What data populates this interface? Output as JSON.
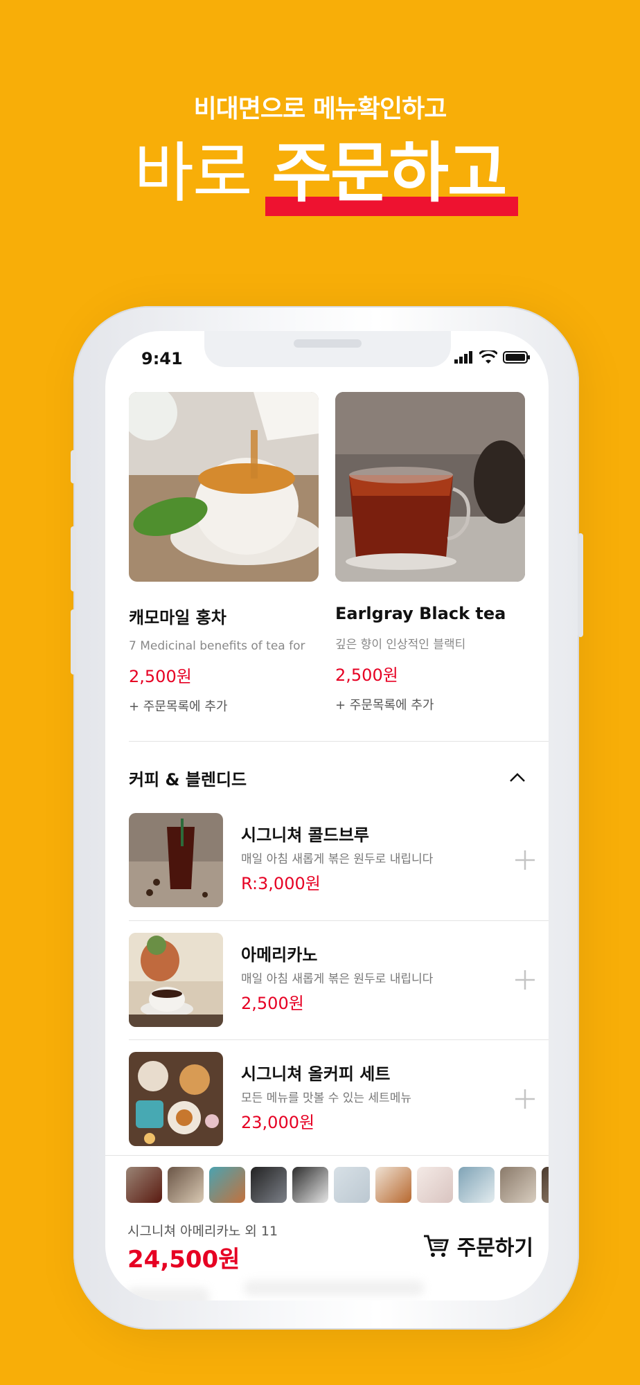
{
  "headline": {
    "sub": "비대면으로 메뉴확인하고",
    "main_thin": "바로",
    "main_bold": "주문하고"
  },
  "status_bar": {
    "time": "9:41"
  },
  "featured": [
    {
      "name": "캐모마일 홍차",
      "desc": "7 Medicinal benefits of tea for",
      "price": "2,500원",
      "add": "+ 주문목록에 추가"
    },
    {
      "name": "Earlgray Black tea",
      "desc": "깊은 향이 인상적인 블랙티",
      "price": "2,500원",
      "add": "+ 주문목록에 추가"
    }
  ],
  "section": {
    "title": "커피 & 블렌디드"
  },
  "items": [
    {
      "name": "시그니쳐 콜드브루",
      "desc": "매일 아침 새롭게 볶은 원두로 내립니다",
      "price": "R:3,000원"
    },
    {
      "name": "아메리카노",
      "desc": "매일 아침 새롭게 볶은 원두로 내립니다",
      "price": "2,500원"
    },
    {
      "name": "시그니쳐 올커피 세트",
      "desc": "모든 메뉴를 맛볼 수 있는 세트메뉴",
      "price": "23,000원"
    }
  ],
  "cart": {
    "summary": "시그니쳐 아메리카노 외 11",
    "total": "24,500원",
    "order_label": "주문하기"
  },
  "colors": {
    "background": "#F8AE08",
    "accent": "#E60023",
    "underline": "#EE1230"
  }
}
